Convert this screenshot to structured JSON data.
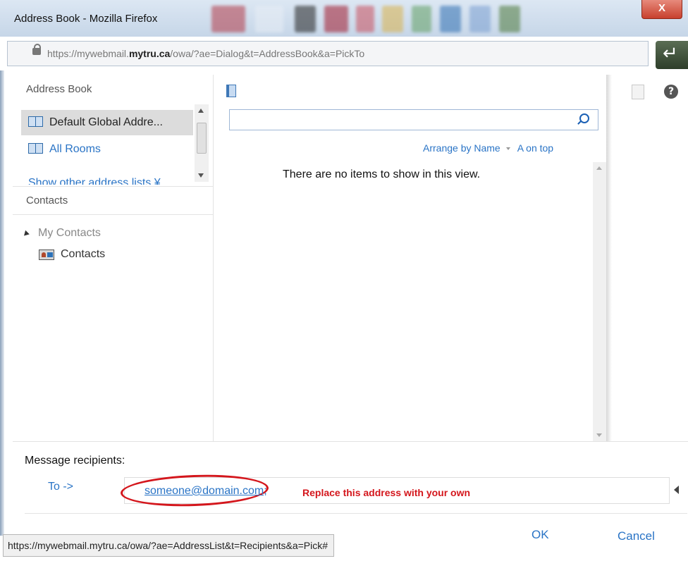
{
  "window": {
    "title": "Address Book - Mozilla Firefox",
    "close_label": "X"
  },
  "urlbar": {
    "url_prefix": "https://mywebmail.",
    "url_domain": "mytru.ca",
    "url_path": "/owa/?ae=Dialog&t=AddressBook&a=PickTo"
  },
  "address_book": {
    "header": "Address Book",
    "lists": [
      {
        "label": "Default Global Addre..."
      },
      {
        "label": "All Rooms"
      }
    ],
    "show_other": "Show other address lists ¥"
  },
  "contacts": {
    "header": "Contacts",
    "folder": "My Contacts",
    "item": "Contacts"
  },
  "list": {
    "search_value": "",
    "arrange_label": "Arrange by Name",
    "sort_order": "A on top",
    "empty_message": "There are no items to show in this view."
  },
  "recipients": {
    "label": "Message recipients:",
    "to_label": "To ->",
    "address": "someone@domain.com;",
    "annotation": "Replace this address with your own"
  },
  "actions": {
    "ok": "OK",
    "cancel": "Cancel"
  },
  "status": {
    "text": "https://mywebmail.mytru.ca/owa/?ae=AddressList&t=Recipients&a=Pick#"
  },
  "colors": {
    "link": "#2a74c6",
    "annotation": "#d4161c",
    "selection": "#dcdcdc"
  },
  "icons": [
    "lock-icon",
    "book-icon",
    "search-icon",
    "help-icon",
    "notes-icon",
    "contact-card-icon"
  ]
}
